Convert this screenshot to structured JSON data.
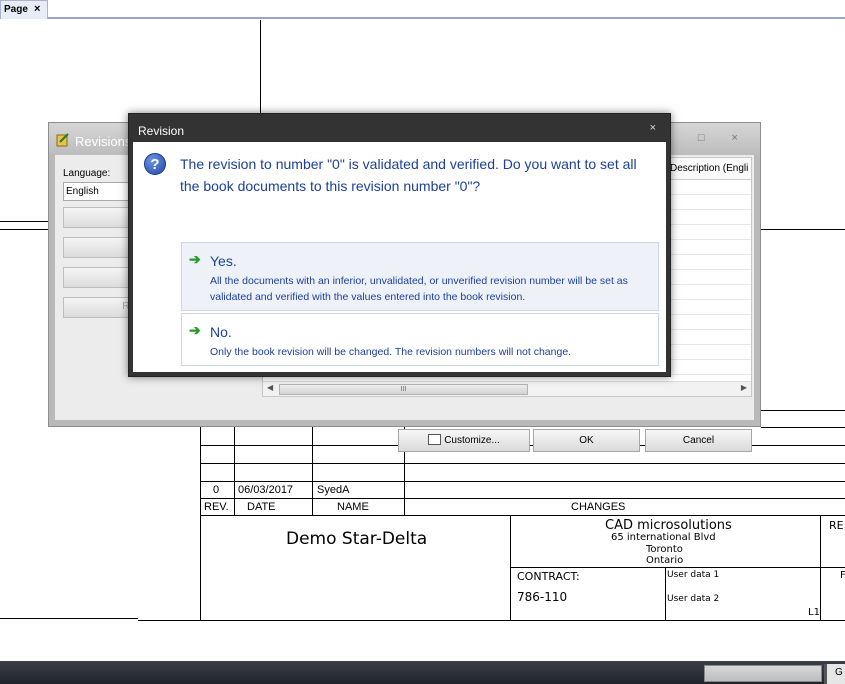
{
  "tab": {
    "label": "Page",
    "close": "×"
  },
  "title_block": {
    "rows": [
      {
        "rev": "0",
        "date": "06/03/2017",
        "name": "SyedA",
        "changes": ""
      }
    ],
    "headers": {
      "rev": "REV.",
      "date": "DATE",
      "name": "NAME",
      "changes": "CHANGES"
    },
    "project_title": "Demo Star-Delta",
    "company": "CAD microsolutions",
    "address_lines": [
      "65 international Blvd",
      "Toronto",
      "Ontario"
    ],
    "contract_label": "CONTRACT:",
    "contract_value": "786-110",
    "user_data_1": "User data 1",
    "user_data_2": "User data 2",
    "rev_label_partial": "RE",
    "sheet_partial": "L1",
    "f_partial": "F"
  },
  "revisions_window": {
    "title": "Revisions",
    "language_label": "Language:",
    "language_value": "English",
    "side_button_partial": "Re",
    "grid_header": "Description (Engli",
    "scroll_grip": "III",
    "buttons": {
      "customize": "Customize...",
      "ok": "OK",
      "cancel": "Cancel"
    },
    "window_controls": "_ □ ×"
  },
  "dialog": {
    "title": "Revision",
    "close": "×",
    "message": "The revision to number \"0\" is validated and verified. Do you want to set all the book documents to this revision number \"0\"?",
    "yes": {
      "title": "Yes.",
      "desc": "All the documents with an inferior, unvalidated, or unverified revision number will be set as validated and verified with the values entered into the book revision."
    },
    "no": {
      "title": "No.",
      "desc": "Only the book revision will be changed. The revision numbers will not change."
    }
  },
  "taskbar": {
    "right_label": "G"
  }
}
